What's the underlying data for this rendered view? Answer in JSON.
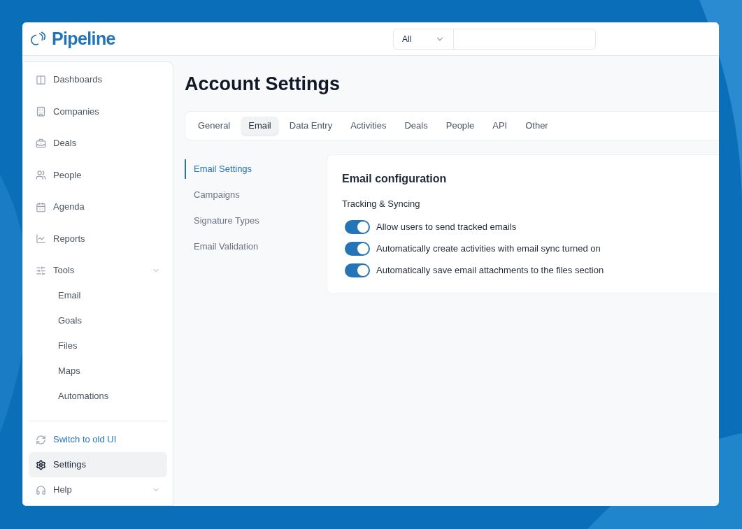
{
  "header": {
    "brand": "Pipeline",
    "search": {
      "scope": "All"
    }
  },
  "sidebar": {
    "items": [
      {
        "kind": "link",
        "label": "Dashboards",
        "selected": false
      },
      {
        "kind": "link",
        "label": "Companies",
        "selected": false
      },
      {
        "kind": "link",
        "label": "Deals",
        "selected": false
      },
      {
        "kind": "link",
        "label": "People",
        "selected": false
      },
      {
        "kind": "link",
        "label": "Agenda",
        "selected": false
      },
      {
        "kind": "link",
        "label": "Reports",
        "selected": false
      },
      {
        "kind": "group",
        "label": "Tools",
        "selected": false,
        "children": [
          {
            "label": "Email",
            "selected": false
          },
          {
            "label": "Goals",
            "selected": false
          },
          {
            "label": "Files",
            "selected": false
          },
          {
            "label": "Maps",
            "selected": false
          },
          {
            "label": "Automations",
            "selected": false
          }
        ]
      }
    ],
    "bottom": [
      {
        "kind": "accent",
        "label": "Switch to old UI",
        "selected": false
      },
      {
        "kind": "link",
        "label": "Settings",
        "selected": true
      },
      {
        "kind": "group",
        "label": "Help",
        "selected": false
      }
    ]
  },
  "page": {
    "title": "Account Settings",
    "tabs": [
      {
        "label": "General",
        "selected": false
      },
      {
        "label": "Email",
        "selected": true
      },
      {
        "label": "Data Entry",
        "selected": false
      },
      {
        "label": "Activities",
        "selected": false
      },
      {
        "label": "Deals",
        "selected": false
      },
      {
        "label": "People",
        "selected": false
      },
      {
        "label": "API",
        "selected": false
      },
      {
        "label": "Other",
        "selected": false
      }
    ],
    "subnav": [
      {
        "label": "Email Settings",
        "selected": true
      },
      {
        "label": "Campaigns",
        "selected": false
      },
      {
        "label": "Signature Types",
        "selected": false
      },
      {
        "label": "Email Validation",
        "selected": false
      }
    ],
    "card": {
      "title": "Email configuration",
      "section": "Tracking & Syncing",
      "toggles": [
        {
          "label": "Allow users to send tracked emails",
          "on": true
        },
        {
          "label": "Automatically create activities with email sync turned on",
          "on": true
        },
        {
          "label": "Automatically save email attachments to the files section",
          "on": true
        }
      ]
    }
  }
}
